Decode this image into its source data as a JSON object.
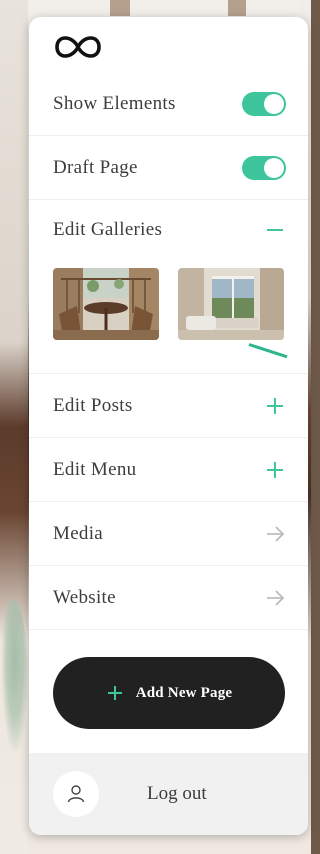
{
  "menu": {
    "items": [
      {
        "label": "Show Elements",
        "control": "toggle",
        "state": "on"
      },
      {
        "label": "Draft Page",
        "control": "toggle",
        "state": "on"
      },
      {
        "label": "Edit Galleries",
        "control": "minus-icon"
      },
      {
        "label": "Edit Posts",
        "control": "plus-icon"
      },
      {
        "label": "Edit Menu",
        "control": "plus-icon"
      },
      {
        "label": "Media",
        "control": "arrow-right-icon"
      },
      {
        "label": "Website",
        "control": "arrow-right-icon"
      }
    ]
  },
  "gallery": {
    "images": [
      "balcony-photo",
      "living-room-photo"
    ]
  },
  "actions": {
    "add_page_label": "Add New Page",
    "logout_label": "Log out"
  },
  "colors": {
    "accent": "#3ec59c",
    "button_bg": "#212121",
    "text": "#3d3d3d",
    "logout_bg": "#f1f1f1"
  }
}
